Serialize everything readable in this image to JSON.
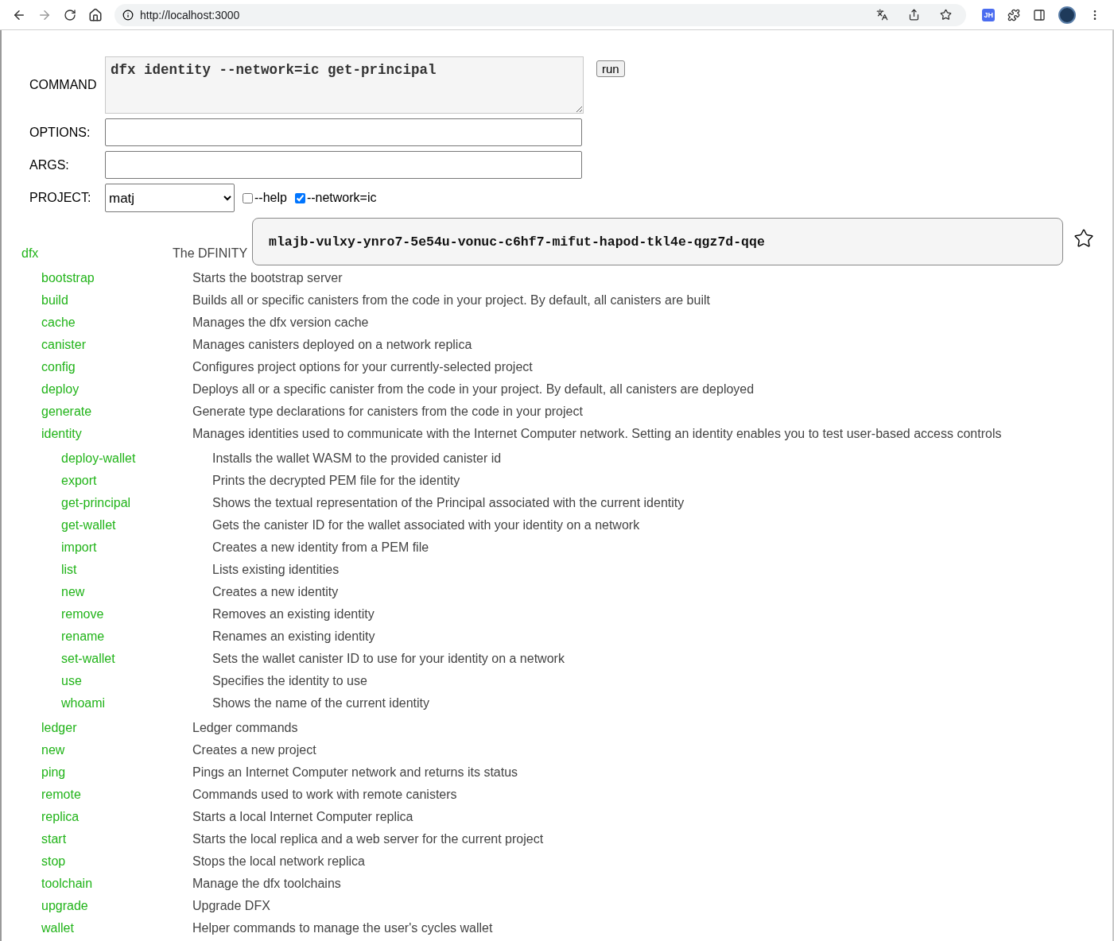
{
  "browser": {
    "url": "http://localhost:3000",
    "extension_badge": "JH"
  },
  "form": {
    "command_label": "COMMAND",
    "command": "dfx identity --network=ic get-principal",
    "run_button": "run",
    "options_label": "OPTIONS:",
    "args_label": "ARGS:",
    "project_label": "PROJECT:",
    "project": "matj",
    "flags": [
      {
        "label": "--help",
        "checked": false
      },
      {
        "label": "--network=ic",
        "checked": true
      }
    ]
  },
  "result": {
    "text": "mlajb-vulxy-ynro7-5e54u-vonuc-c6hf7-mifut-hapod-tkl4e-qgz7d-qqe"
  },
  "commands": [
    {
      "name": "dfx",
      "description": "The DFINITY",
      "children": [
        {
          "name": "bootstrap",
          "description": "Starts the bootstrap server"
        },
        {
          "name": "build",
          "description": "Builds all or specific canisters from the code in your project. By default, all canisters are built"
        },
        {
          "name": "cache",
          "description": "Manages the dfx version cache"
        },
        {
          "name": "canister",
          "description": "Manages canisters deployed on a network replica"
        },
        {
          "name": "config",
          "description": "Configures project options for your currently-selected project"
        },
        {
          "name": "deploy",
          "description": "Deploys all or a specific canister from the code in your project. By default, all canisters are deployed"
        },
        {
          "name": "generate",
          "description": "Generate type declarations for canisters from the code in your project"
        },
        {
          "name": "identity",
          "description": "Manages identities used to communicate with the Internet Computer network. Setting an identity enables you to test user-based access controls",
          "children": [
            {
              "name": "deploy-wallet",
              "description": "Installs the wallet WASM to the provided canister id"
            },
            {
              "name": "export",
              "description": "Prints the decrypted PEM file for the identity"
            },
            {
              "name": "get-principal",
              "description": "Shows the textual representation of the Principal associated with the current identity"
            },
            {
              "name": "get-wallet",
              "description": "Gets the canister ID for the wallet associated with your identity on a network"
            },
            {
              "name": "import",
              "description": "Creates a new identity from a PEM file"
            },
            {
              "name": "list",
              "description": "Lists existing identities"
            },
            {
              "name": "new",
              "description": "Creates a new identity"
            },
            {
              "name": "remove",
              "description": "Removes an existing identity"
            },
            {
              "name": "rename",
              "description": "Renames an existing identity"
            },
            {
              "name": "set-wallet",
              "description": "Sets the wallet canister ID to use for your identity on a network"
            },
            {
              "name": "use",
              "description": "Specifies the identity to use"
            },
            {
              "name": "whoami",
              "description": "Shows the name of the current identity"
            }
          ]
        },
        {
          "name": "ledger",
          "description": "Ledger commands"
        },
        {
          "name": "new",
          "description": "Creates a new project"
        },
        {
          "name": "ping",
          "description": "Pings an Internet Computer network and returns its status"
        },
        {
          "name": "remote",
          "description": "Commands used to work with remote canisters"
        },
        {
          "name": "replica",
          "description": "Starts a local Internet Computer replica"
        },
        {
          "name": "start",
          "description": "Starts the local replica and a web server for the current project"
        },
        {
          "name": "stop",
          "description": "Stops the local network replica"
        },
        {
          "name": "toolchain",
          "description": "Manage the dfx toolchains"
        },
        {
          "name": "upgrade",
          "description": "Upgrade DFX"
        },
        {
          "name": "wallet",
          "description": "Helper commands to manage the user's cycles wallet"
        }
      ]
    }
  ]
}
